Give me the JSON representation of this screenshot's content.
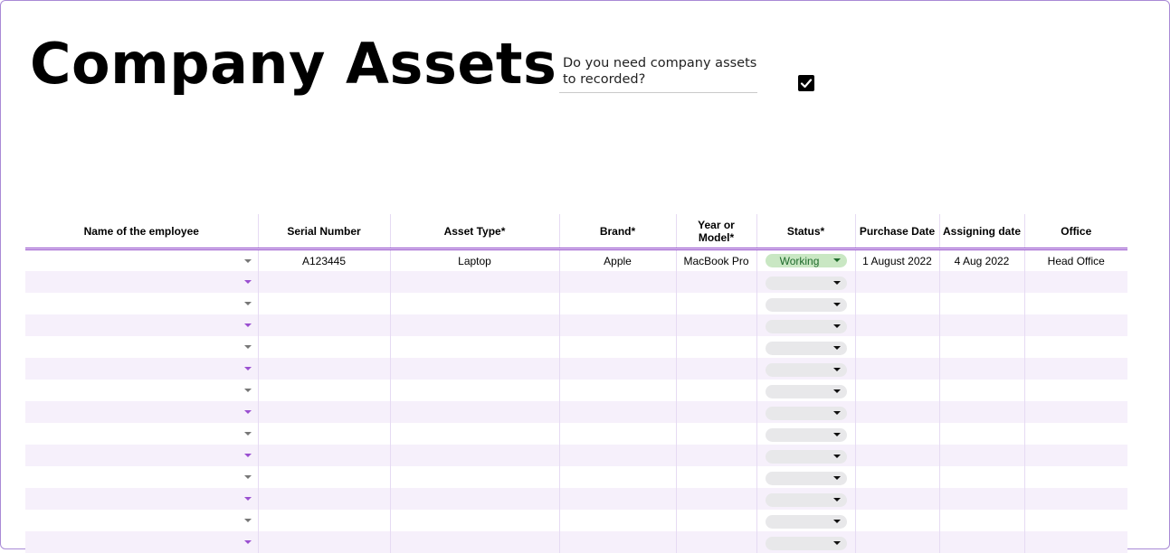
{
  "header": {
    "title": "Company Assets",
    "question": "Do you need company assets to recorded?",
    "checkbox_checked": true
  },
  "table": {
    "columns": [
      "Name of the employee",
      "Serial Number",
      "Asset Type*",
      "Brand*",
      "Year or Model*",
      "Status*",
      "Purchase Date",
      "Assigning date",
      "Office"
    ],
    "rows": [
      {
        "employee": "",
        "serial": "A123445",
        "asset_type": "Laptop",
        "brand": "Apple",
        "model": "MacBook Pro",
        "status": "Working",
        "purchase_date": "1 August 2022",
        "assigning_date": "4 Aug 2022",
        "office": "Head Office"
      },
      {
        "employee": "",
        "serial": "",
        "asset_type": "",
        "brand": "",
        "model": "",
        "status": "",
        "purchase_date": "",
        "assigning_date": "",
        "office": ""
      },
      {
        "employee": "",
        "serial": "",
        "asset_type": "",
        "brand": "",
        "model": "",
        "status": "",
        "purchase_date": "",
        "assigning_date": "",
        "office": ""
      },
      {
        "employee": "",
        "serial": "",
        "asset_type": "",
        "brand": "",
        "model": "",
        "status": "",
        "purchase_date": "",
        "assigning_date": "",
        "office": ""
      },
      {
        "employee": "",
        "serial": "",
        "asset_type": "",
        "brand": "",
        "model": "",
        "status": "",
        "purchase_date": "",
        "assigning_date": "",
        "office": ""
      },
      {
        "employee": "",
        "serial": "",
        "asset_type": "",
        "brand": "",
        "model": "",
        "status": "",
        "purchase_date": "",
        "assigning_date": "",
        "office": ""
      },
      {
        "employee": "",
        "serial": "",
        "asset_type": "",
        "brand": "",
        "model": "",
        "status": "",
        "purchase_date": "",
        "assigning_date": "",
        "office": ""
      },
      {
        "employee": "",
        "serial": "",
        "asset_type": "",
        "brand": "",
        "model": "",
        "status": "",
        "purchase_date": "",
        "assigning_date": "",
        "office": ""
      },
      {
        "employee": "",
        "serial": "",
        "asset_type": "",
        "brand": "",
        "model": "",
        "status": "",
        "purchase_date": "",
        "assigning_date": "",
        "office": ""
      },
      {
        "employee": "",
        "serial": "",
        "asset_type": "",
        "brand": "",
        "model": "",
        "status": "",
        "purchase_date": "",
        "assigning_date": "",
        "office": ""
      },
      {
        "employee": "",
        "serial": "",
        "asset_type": "",
        "brand": "",
        "model": "",
        "status": "",
        "purchase_date": "",
        "assigning_date": "",
        "office": ""
      },
      {
        "employee": "",
        "serial": "",
        "asset_type": "",
        "brand": "",
        "model": "",
        "status": "",
        "purchase_date": "",
        "assigning_date": "",
        "office": ""
      },
      {
        "employee": "",
        "serial": "",
        "asset_type": "",
        "brand": "",
        "model": "",
        "status": "",
        "purchase_date": "",
        "assigning_date": "",
        "office": ""
      },
      {
        "employee": "",
        "serial": "",
        "asset_type": "",
        "brand": "",
        "model": "",
        "status": "",
        "purchase_date": "",
        "assigning_date": "",
        "office": ""
      }
    ]
  },
  "colors": {
    "accent": "#8b3fc7",
    "band": "#f6f0fb",
    "status_working_bg": "#c9e7c3",
    "status_working_text": "#1f6b2c",
    "status_empty_bg": "#e8e8ea"
  }
}
